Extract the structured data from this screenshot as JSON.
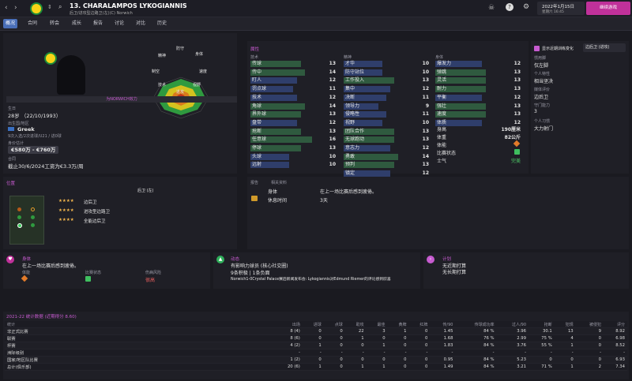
{
  "header": {
    "player_name": "13. CHARALAMPOS LYKOGIANNIS",
    "subtitle": "后卫/进攻型边路卫(左)(C) Norwich",
    "date": "2022年1月15日",
    "weekday_time": "星期六 16:45",
    "continue_label": "继续游戏"
  },
  "tabs": [
    "概况",
    "合同",
    "转会",
    "成长",
    "报告",
    "讨论",
    "对比",
    "历史"
  ],
  "overview": {
    "role_bar": "为NORWICH效力",
    "age_label": "生日",
    "age": "28岁 （22/10/1993）",
    "birthplace_label": "出生国/地区",
    "nation": "Greek",
    "caps": "9次入选/2次进球/U21 / 进0球",
    "value_label": "身价估计",
    "value": "€580万 - €760万",
    "contract_label": "合同",
    "contract": "截止30/6/2024工资为€3.3万/周"
  },
  "radar_labels": [
    "防守",
    "身体",
    "速度",
    "视野",
    "进攻",
    "技术",
    "制空",
    "精神"
  ],
  "attributes": {
    "title": "属性",
    "show_training": "显示近期训练变化",
    "position_select": "边后卫 (进攻)",
    "technical_header": "技术",
    "mental_header": "精神",
    "physical_header": "身体",
    "technical": [
      [
        "传球",
        "13"
      ],
      [
        "传中",
        "14"
      ],
      [
        "盯人",
        "12"
      ],
      [
        "罚点球",
        "11"
      ],
      [
        "技术",
        "12"
      ],
      [
        "角球",
        "14"
      ],
      [
        "界外球",
        "13"
      ],
      [
        "盘带",
        "12"
      ],
      [
        "抢断",
        "13"
      ],
      [
        "任意球",
        "16"
      ],
      [
        "停球",
        "13"
      ],
      [
        "头球",
        "10"
      ],
      [
        "远射",
        "10"
      ]
    ],
    "mental": [
      [
        "才华",
        "10"
      ],
      [
        "防守站位",
        "10"
      ],
      [
        "工作投入",
        "13"
      ],
      [
        "集中",
        "12"
      ],
      [
        "决断",
        "11"
      ],
      [
        "领导力",
        "9"
      ],
      [
        "侵略性",
        "11"
      ],
      [
        "视野",
        "10"
      ],
      [
        "团队合作",
        "13"
      ],
      [
        "无球跑动",
        "13"
      ],
      [
        "意志力",
        "12"
      ],
      [
        "勇敢",
        "14"
      ],
      [
        "预判",
        "13"
      ],
      [
        "镇定",
        "12"
      ]
    ],
    "physical": [
      [
        "爆发力",
        "12"
      ],
      [
        "弹跳",
        "13"
      ],
      [
        "灵活",
        "13"
      ],
      [
        "耐力",
        "13"
      ],
      [
        "平衡",
        "12"
      ],
      [
        "强壮",
        "13"
      ],
      [
        "速度",
        "13"
      ],
      [
        "体质",
        "12"
      ]
    ],
    "height_label": "身高",
    "height": "190厘米",
    "weight_label": "体重",
    "weight": "82公斤",
    "ability_label": "体能",
    "match_label": "比赛状态",
    "morale_label": "士气",
    "morale": "完美"
  },
  "side_info": [
    [
      "惯用脚",
      "仅左脚"
    ],
    [
      "个人特性",
      "相当坚决"
    ],
    [
      "媒体评价",
      "边后卫"
    ],
    [
      "守门能力",
      "3"
    ],
    [
      "个人习惯",
      "大力射门"
    ]
  ],
  "positions": {
    "title": "位置",
    "main": "后卫 (左)",
    "list": [
      [
        "★★★★",
        "边后卫"
      ],
      [
        "★★★★",
        "进攻型边路卫"
      ],
      [
        "★★★★",
        "全能边后卫"
      ]
    ]
  },
  "fitness": {
    "col1": "报告",
    "col2": "相关资料",
    "rows": [
      [
        "身体",
        "在上一场比赛后感到疲倦。"
      ],
      [
        "休息时间",
        "3天"
      ]
    ]
  },
  "cards": {
    "body": {
      "title": "身体",
      "text": "在上一场比赛后感到疲倦。",
      "l1": "体能",
      "l2": "比赛状态",
      "l3": "伤病风险",
      "risk": "很高"
    },
    "news": {
      "title": "动态",
      "line1": "有影响力球员 (核心社交圈)",
      "line2": "9条积极 | 1条负面",
      "line3": "Norwich1-0Crystal Palace赛后新闻发布会: Lykogiannis对Edmund Riemer的评论感到欣喜"
    },
    "plan": {
      "title": "计划",
      "line1": "无近期打算",
      "line2": "无长期打算"
    }
  },
  "stats": {
    "title": "2021-22 统计数据 (近期得分 8.60)",
    "headers": [
      "统计",
      "出场",
      "进球",
      "点球",
      "助攻",
      "最佳",
      "黄牌",
      "红牌",
      "传/90",
      "传球成功率",
      "过人/90",
      "抢断",
      "犯规",
      "被侵犯",
      "评分"
    ],
    "rows": [
      [
        "非正式比赛",
        "8 (4)",
        "0",
        "0",
        "22",
        "3",
        "1",
        "0",
        "1.45",
        "84 %",
        "3.96",
        "30.1",
        "13",
        "9",
        "8.92"
      ],
      [
        "联赛",
        "8 (6)",
        "0",
        "0",
        "1",
        "0",
        "0",
        "0",
        "1.68",
        "76 %",
        "2.99",
        "75 %",
        "4",
        "0",
        "6.98"
      ],
      [
        "杯赛",
        "4 (2)",
        "1",
        "0",
        "0",
        "1",
        "0",
        "0",
        "1.83",
        "84 %",
        "3.76",
        "55 %",
        "1",
        "0",
        "8.52"
      ],
      [
        "洲际级别",
        "-",
        "-",
        "-",
        "-",
        "-",
        "-",
        "-",
        "-",
        "-",
        "-",
        "-",
        "-",
        "-",
        "-"
      ],
      [
        "国家/地区队比赛",
        "1 (2)",
        "0",
        "0",
        "0",
        "0",
        "0",
        "0",
        "0.95",
        "84 %",
        "5.23",
        "0",
        "0",
        "0",
        "6.93"
      ],
      [
        "总计(俱乐部)",
        "20 (6)",
        "1",
        "0",
        "1",
        "1",
        "0",
        "0",
        "1.49",
        "84 %",
        "3.21",
        "71 %",
        "1",
        "2",
        "7.34"
      ]
    ]
  },
  "colors": {
    "accent": "#c75bd0",
    "tab_active": "#4a6fb8",
    "bar_blue": "#2f3e6b",
    "bar_green": "#2f5a3f",
    "gold": "#f0b44c"
  },
  "icons": [
    "back-icon",
    "forward-icon",
    "club-badge-icon",
    "search-icon",
    "settings-icon",
    "help-icon"
  ]
}
